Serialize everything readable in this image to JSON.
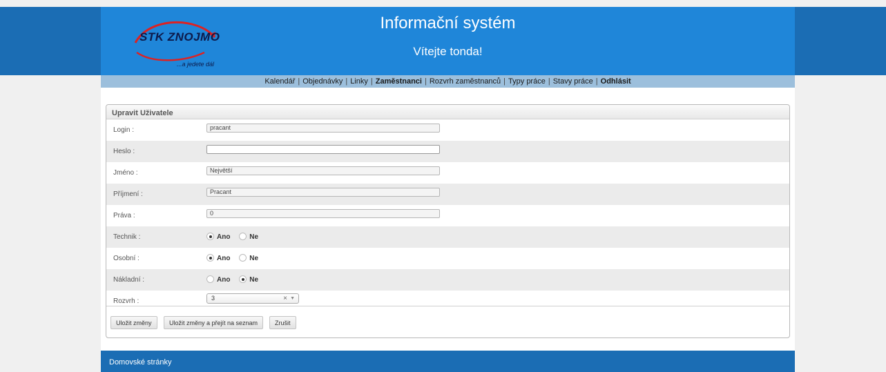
{
  "header": {
    "title": "Informační systém",
    "welcome": "Vítejte tonda!",
    "logo": {
      "name": "STK ZNOJMO",
      "tagline": "...a jedete dál"
    }
  },
  "menu": [
    {
      "label": "Kalendář",
      "bold": false
    },
    {
      "label": "Objednávky",
      "bold": false
    },
    {
      "label": "Linky",
      "bold": false
    },
    {
      "label": "Zaměstnanci",
      "bold": true
    },
    {
      "label": "Rozvrh zaměstnanců",
      "bold": false
    },
    {
      "label": "Typy práce",
      "bold": false
    },
    {
      "label": "Stavy práce",
      "bold": false
    },
    {
      "label": "Odhlásit",
      "bold": true
    }
  ],
  "form": {
    "title": "Upravit Uživatele",
    "login": {
      "label": "Login :",
      "value": "pracant"
    },
    "heslo": {
      "label": "Heslo :",
      "value": ""
    },
    "jmeno": {
      "label": "Jméno :",
      "value": "Největší"
    },
    "prijmeni": {
      "label": "Příjmení :",
      "value": "Pracant"
    },
    "prava": {
      "label": "Práva :",
      "value": "0"
    },
    "technik": {
      "label": "Technik :",
      "selected": "Ano"
    },
    "osobni": {
      "label": "Osobní :",
      "selected": "Ano"
    },
    "nakladni": {
      "label": "Nákladní :",
      "selected": "Ne"
    },
    "radio_yes": "Ano",
    "radio_no": "Ne",
    "rozvrh": {
      "label": "Rozvrh :",
      "value": "3",
      "clear": "×",
      "arrow": "▼"
    }
  },
  "buttons": {
    "save": "Uložit změny",
    "save_list": "Uložit změny a přejít na seznam",
    "cancel": "Zrušit"
  },
  "footer": {
    "link": "Domovské stránky"
  },
  "colors": {
    "header_bg": "#1f86d9",
    "band_bg": "#1b6db4",
    "menu_bg": "#9cbfdc"
  }
}
